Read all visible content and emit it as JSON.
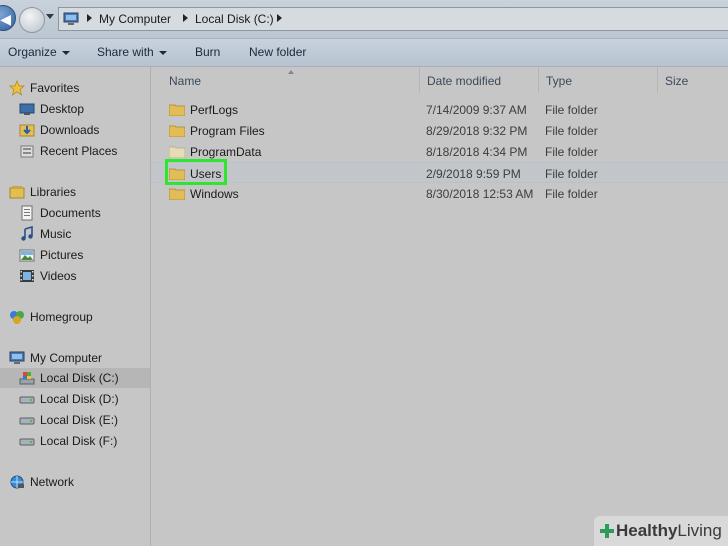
{
  "address_bar": {
    "crumbs": [
      "My Computer",
      "Local Disk (C:)"
    ]
  },
  "toolbar": {
    "organize_label": "Organize",
    "share_label": "Share with",
    "burn_label": "Burn",
    "new_folder_label": "New folder"
  },
  "sidebar": {
    "favorites": {
      "label": "Favorites",
      "items": [
        {
          "label": "Desktop",
          "icon": "desktop-icon"
        },
        {
          "label": "Downloads",
          "icon": "downloads-icon"
        },
        {
          "label": "Recent Places",
          "icon": "recent-places-icon"
        }
      ]
    },
    "libraries": {
      "label": "Libraries",
      "items": [
        {
          "label": "Documents",
          "icon": "documents-icon"
        },
        {
          "label": "Music",
          "icon": "music-icon"
        },
        {
          "label": "Pictures",
          "icon": "pictures-icon"
        },
        {
          "label": "Videos",
          "icon": "videos-icon"
        }
      ]
    },
    "homegroup": {
      "label": "Homegroup"
    },
    "computer": {
      "label": "My Computer",
      "items": [
        {
          "label": "Local Disk (C:)",
          "icon": "system-drive-icon",
          "selected": true
        },
        {
          "label": "Local Disk (D:)",
          "icon": "drive-icon"
        },
        {
          "label": "Local Disk (E:)",
          "icon": "drive-icon"
        },
        {
          "label": "Local Disk (F:)",
          "icon": "drive-icon"
        }
      ]
    },
    "network": {
      "label": "Network"
    }
  },
  "columns": {
    "name": "Name",
    "date_modified": "Date modified",
    "type": "Type",
    "size": "Size"
  },
  "files": [
    {
      "name": "PerfLogs",
      "date": "7/14/2009 9:37 AM",
      "type": "File folder"
    },
    {
      "name": "Program Files",
      "date": "8/29/2018 9:32 PM",
      "type": "File folder"
    },
    {
      "name": "ProgramData",
      "date": "8/18/2018 4:34 PM",
      "type": "File folder"
    },
    {
      "name": "Users",
      "date": "2/9/2018 9:59 PM",
      "type": "File folder",
      "highlighted": true
    },
    {
      "name": "Windows",
      "date": "8/30/2018 12:53 AM",
      "type": "File folder"
    }
  ],
  "watermark": {
    "part1": "Healthy",
    "part2": "Living"
  },
  "colors": {
    "highlight": "#2ee62e",
    "folder": "#e8c35a"
  }
}
